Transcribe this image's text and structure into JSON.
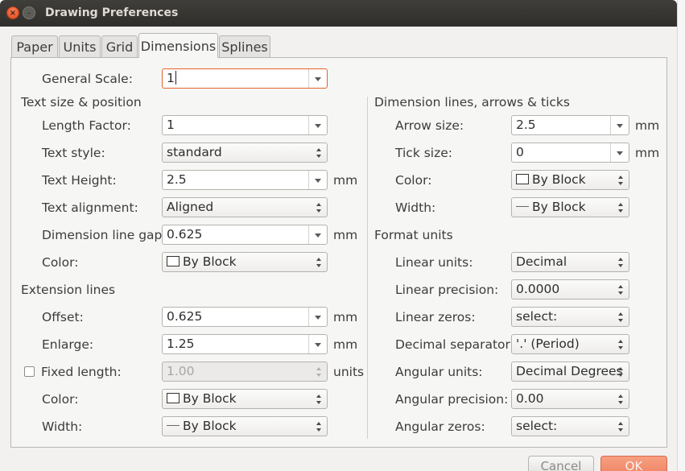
{
  "window": {
    "title": "Drawing Preferences"
  },
  "tabs": [
    {
      "label": "Paper",
      "active": false
    },
    {
      "label": "Units",
      "active": false
    },
    {
      "label": "Grid",
      "active": false
    },
    {
      "label": "Dimensions",
      "active": true
    },
    {
      "label": "Splines",
      "active": false
    }
  ],
  "general": {
    "scale_label": "General Scale:",
    "scale_value": "1"
  },
  "text": {
    "section": "Text size & position",
    "length_factor_label": "Length Factor:",
    "length_factor": "1",
    "style_label": "Text style:",
    "style": "standard",
    "height_label": "Text Height:",
    "height": "2.5",
    "height_unit": "mm",
    "alignment_label": "Text alignment:",
    "alignment": "Aligned",
    "gap_label": "Dimension line gap:",
    "gap": "0.625",
    "gap_unit": "mm",
    "color_label": "Color:",
    "color": "By Block"
  },
  "extension": {
    "section": "Extension lines",
    "offset_label": "Offset:",
    "offset": "0.625",
    "offset_unit": "mm",
    "enlarge_label": "Enlarge:",
    "enlarge": "1.25",
    "enlarge_unit": "mm",
    "fixed_label": "Fixed length:",
    "fixed_checked": false,
    "fixed": "1.00",
    "fixed_unit": "units",
    "color_label": "Color:",
    "color": "By Block",
    "width_label": "Width:",
    "width": "By Block"
  },
  "dimlines": {
    "section": "Dimension lines, arrows & ticks",
    "arrow_label": "Arrow size:",
    "arrow": "2.5",
    "arrow_unit": "mm",
    "tick_label": "Tick size:",
    "tick": "0",
    "tick_unit": "mm",
    "color_label": "Color:",
    "color": "By Block",
    "width_label": "Width:",
    "width": "By Block"
  },
  "format": {
    "section": "Format units",
    "linear_units_label": "Linear units:",
    "linear_units": "Decimal",
    "linear_precision_label": "Linear precision:",
    "linear_precision": "0.0000",
    "linear_zeros_label": "Linear zeros:",
    "linear_zeros": "select:",
    "decimal_sep_label": "Decimal separator:",
    "decimal_sep": "'.' (Period)",
    "angular_units_label": "Angular units:",
    "angular_units": "Decimal Degrees",
    "angular_precision_label": "Angular precision:",
    "angular_precision": "0.00",
    "angular_zeros_label": "Angular zeros:",
    "angular_zeros": "select:"
  },
  "buttons": {
    "cancel": "Cancel",
    "ok": "OK"
  },
  "colors": {
    "titlebar": "#3a3935",
    "focus": "#e8622c",
    "ok_button": "#f08a6a",
    "dialog_bg": "#f2f1f0"
  }
}
